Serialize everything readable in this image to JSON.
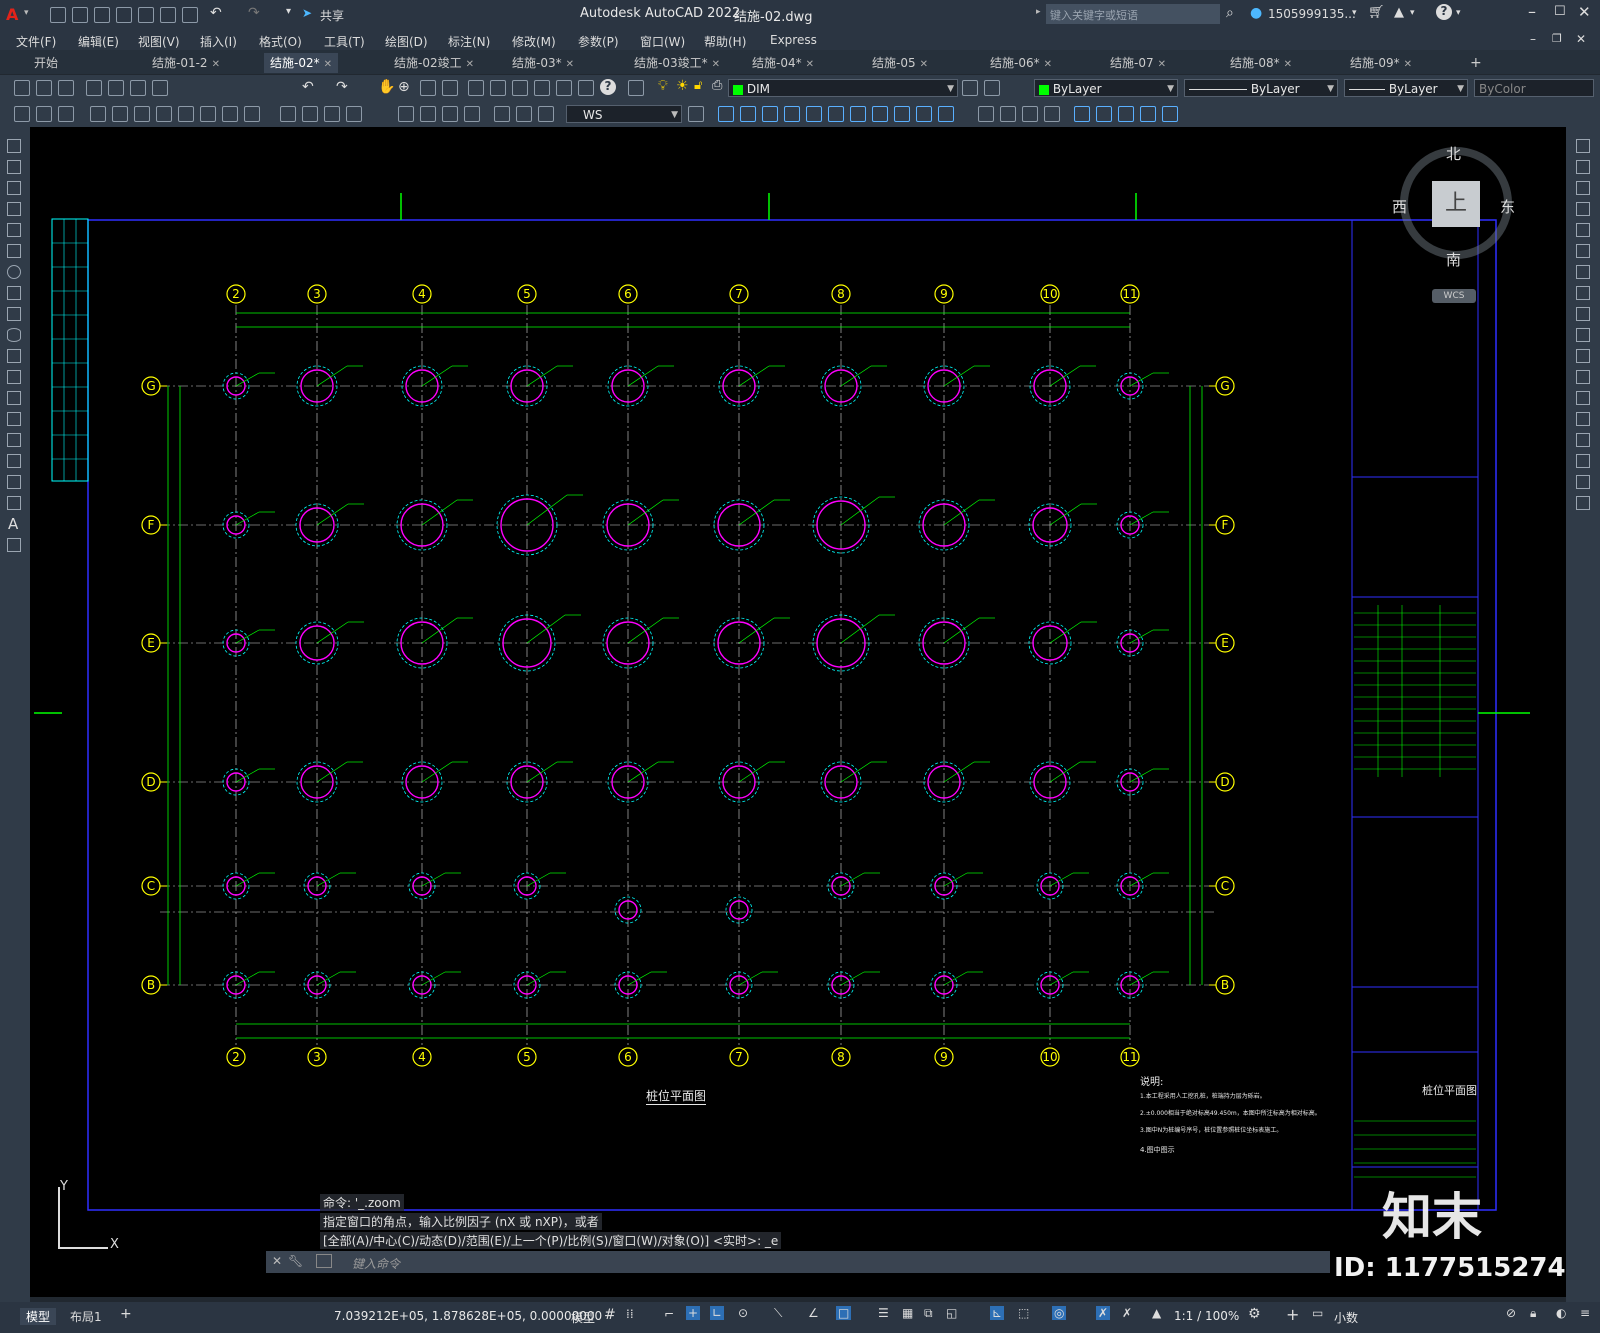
{
  "app": {
    "title": "Autodesk AutoCAD 2022",
    "filename": "结施-02.dwg",
    "share_label": "共享",
    "search_placeholder": "键入关键字或短语",
    "user": "1505999135...",
    "help": "?"
  },
  "menu": [
    "文件(F)",
    "编辑(E)",
    "视图(V)",
    "插入(I)",
    "格式(O)",
    "工具(T)",
    "绘图(D)",
    "标注(N)",
    "修改(M)",
    "参数(P)",
    "窗口(W)",
    "帮助(H)",
    "Express"
  ],
  "tabs": [
    {
      "label": "开始"
    },
    {
      "label": "结施-01-2"
    },
    {
      "label": "结施-02*",
      "active": true
    },
    {
      "label": "结施-02竣工"
    },
    {
      "label": "结施-03*"
    },
    {
      "label": "结施-03竣工*"
    },
    {
      "label": "结施-04*"
    },
    {
      "label": "结施-05"
    },
    {
      "label": "结施-06*"
    },
    {
      "label": "结施-07"
    },
    {
      "label": "结施-08*"
    },
    {
      "label": "结施-09*"
    }
  ],
  "toolbar": {
    "layer": "DIM",
    "color": "ByLayer",
    "linetype": "ByLayer",
    "lineweight": "ByLayer",
    "plotstyle": "ByColor",
    "ucs": "WS"
  },
  "viewcube": {
    "north": "北",
    "south": "南",
    "east": "东",
    "west": "西",
    "top": "上",
    "wcs": "WCS"
  },
  "drawing": {
    "axes_top": [
      "2",
      "3",
      "4",
      "5",
      "6",
      "7",
      "8",
      "9",
      "10",
      "11"
    ],
    "axes_side": [
      "G",
      "F",
      "E",
      "D",
      "C",
      "B"
    ],
    "title": "桩位平面图",
    "notes_title": "说明:",
    "notes": [
      "1.本工程采用人工挖孔桩，桩端持力层为砾岩。",
      "2.±0.000相当于绝对标高49.450m，本图中所注标高为相对标高。",
      "3.图中N为桩编号序号，桩位置参照桩位坐标表施工。",
      "4.图中图示"
    ],
    "titleblock_name": "桩位平面图"
  },
  "command": {
    "history": [
      "命令: '_.zoom",
      "指定窗口的角点，输入比例因子 (nX 或 nXP)，或者",
      "[全部(A)/中心(C)/动态(D)/范围(E)/上一个(P)/比例(S)/窗口(W)/对象(O)] <实时>: _e"
    ],
    "placeholder": "键入命令"
  },
  "status": {
    "tab_model": "模型",
    "tab_layout": "布局1",
    "coords": "7.039212E+05, 1.878628E+05, 0.00000000",
    "space": "模型",
    "scale": "1:1 / 100%",
    "units": "小数"
  },
  "watermark": {
    "logo": "知末",
    "id": "ID: 1177515274"
  }
}
